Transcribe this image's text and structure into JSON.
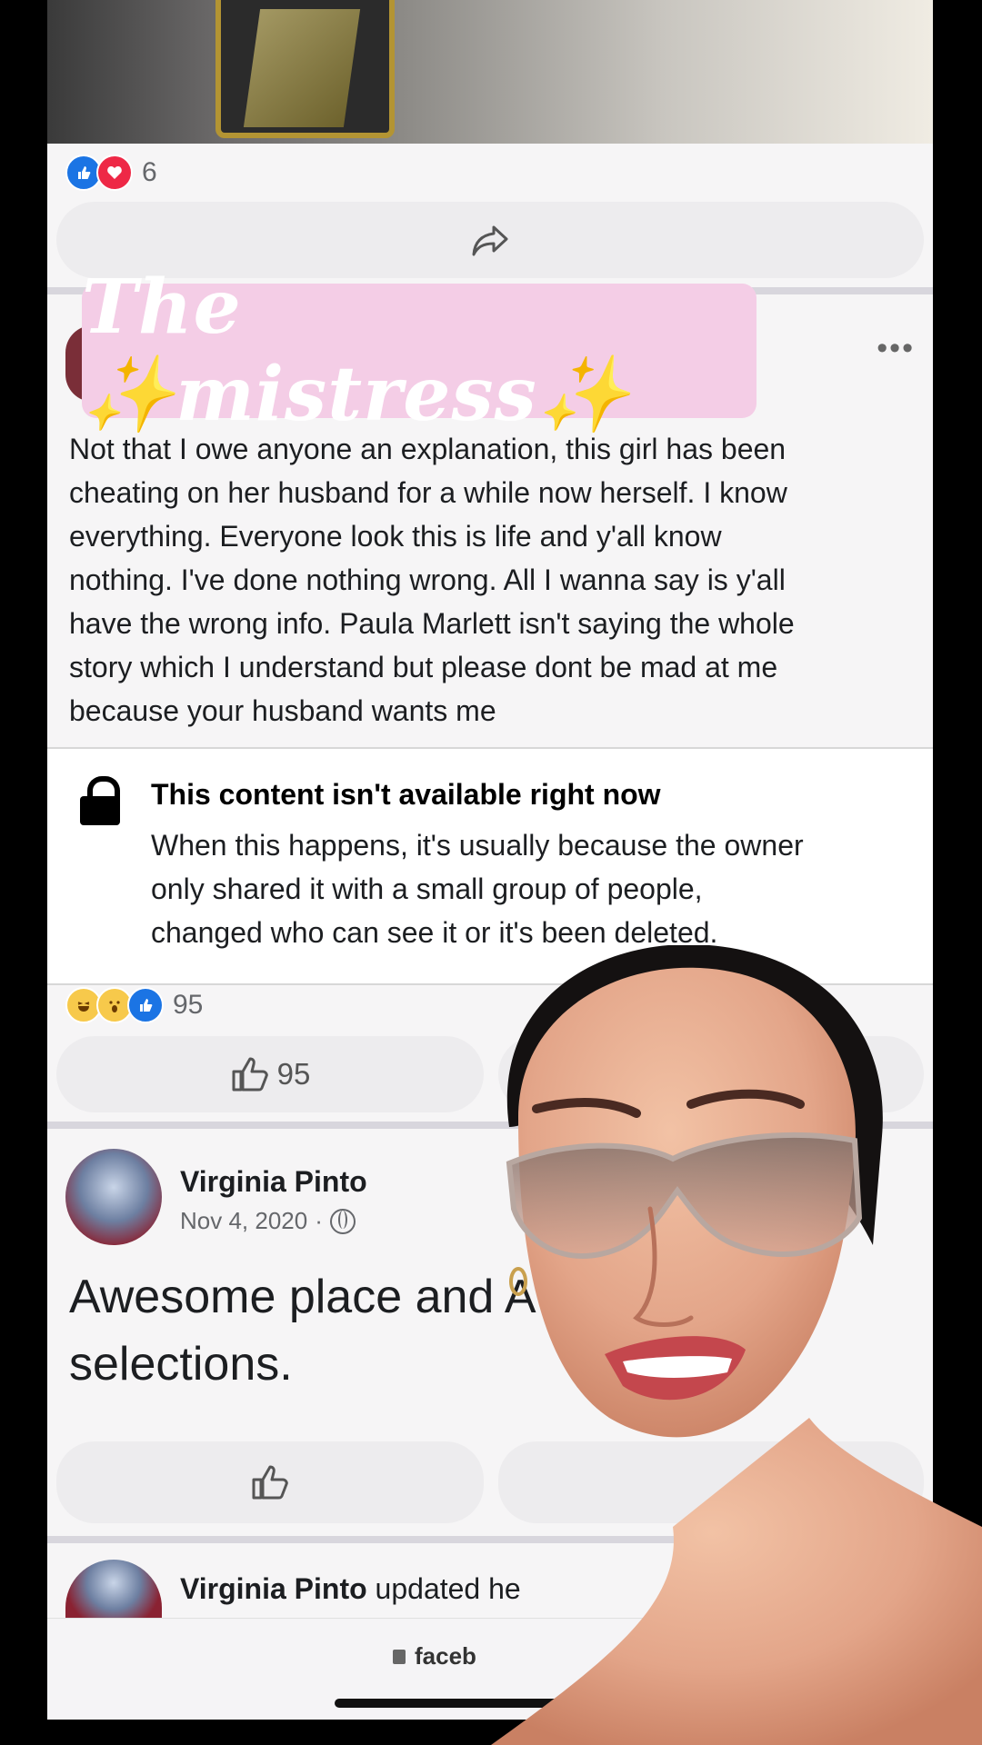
{
  "top_post": {
    "reaction_icons": [
      "like-icon",
      "love-icon"
    ],
    "reaction_count": "6"
  },
  "overlay_title": {
    "word1": "The",
    "sparkle_left": "✨",
    "word2": "mistress",
    "sparkle_right": "✨"
  },
  "more_menu": "•••",
  "post": {
    "lines": [
      "Not that I owe anyone an explanation, this girl has been",
      "cheating on her husband for a while now herself. I know",
      "everything. Everyone look this is life and y'all know",
      "nothing. I've done nothing wrong. All I wanna say is y'all",
      "have the wrong info. Paula Marlett isn't saying the whole",
      "story which I understand but please dont be mad at me",
      "because your husband wants me"
    ]
  },
  "unavailable": {
    "title": "This content isn't available right now",
    "lines": [
      "When this happens, it's usually because the owner",
      "only shared it with a small group of people,",
      "changed who can see it or it's been deleted."
    ]
  },
  "post_reactions": {
    "icons": [
      "haha-icon",
      "wow-icon",
      "like-icon"
    ],
    "count": "95",
    "like_button_count": "95"
  },
  "review_post": {
    "author": "Virginia Pinto",
    "date": "Nov 4, 2020",
    "separator": "·",
    "lines": [
      "Awesome place and Av",
      "selections."
    ]
  },
  "next_post": {
    "author": "Virginia Pinto",
    "action": "updated he"
  },
  "browser": {
    "url": "faceb"
  },
  "colors": {
    "facebook_blue": "#1b74e4",
    "love_red": "#ee2846",
    "banner_pink": "#f4cde6",
    "sparkle_gold": "#f7d23a"
  }
}
